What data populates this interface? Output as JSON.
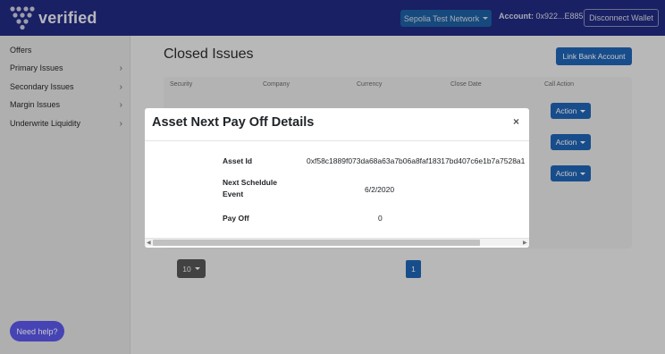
{
  "brand": {
    "name": "verified"
  },
  "header": {
    "network": "Sepolia Test Network",
    "account_label": "Account:",
    "account_value": "0x922...E885",
    "disconnect": "Disconnect Wallet"
  },
  "sidebar": {
    "items": [
      {
        "label": "Offers",
        "chevron": false
      },
      {
        "label": "Primary Issues",
        "chevron": true
      },
      {
        "label": "Secondary Issues",
        "chevron": true
      },
      {
        "label": "Margin Issues",
        "chevron": true
      },
      {
        "label": "Underwrite Liquidity",
        "chevron": true
      }
    ],
    "help": "Need help?"
  },
  "main": {
    "title": "Closed Issues",
    "link_bank": "Link Bank Account",
    "table": {
      "columns": [
        "Security",
        "Company",
        "Currency",
        "Close Date",
        "Call Action"
      ],
      "action_label": "Action"
    },
    "pagination": {
      "page_size": "10",
      "current_page": "1"
    }
  },
  "modal": {
    "title": "Asset Next Pay Off Details",
    "close": "×",
    "rows": [
      {
        "label": "Asset Id",
        "value": "0xf58c1889f073da68a63a7b06a8faf18317bd407c6e1b7a7528a1"
      },
      {
        "label": "Next Scheldule Event",
        "value": "6/2/2020"
      },
      {
        "label": "Pay Off",
        "value": "0"
      }
    ]
  },
  "colors": {
    "navbar": "#212980",
    "primary_button": "#1f63b4",
    "help_button": "#5a57e8"
  }
}
